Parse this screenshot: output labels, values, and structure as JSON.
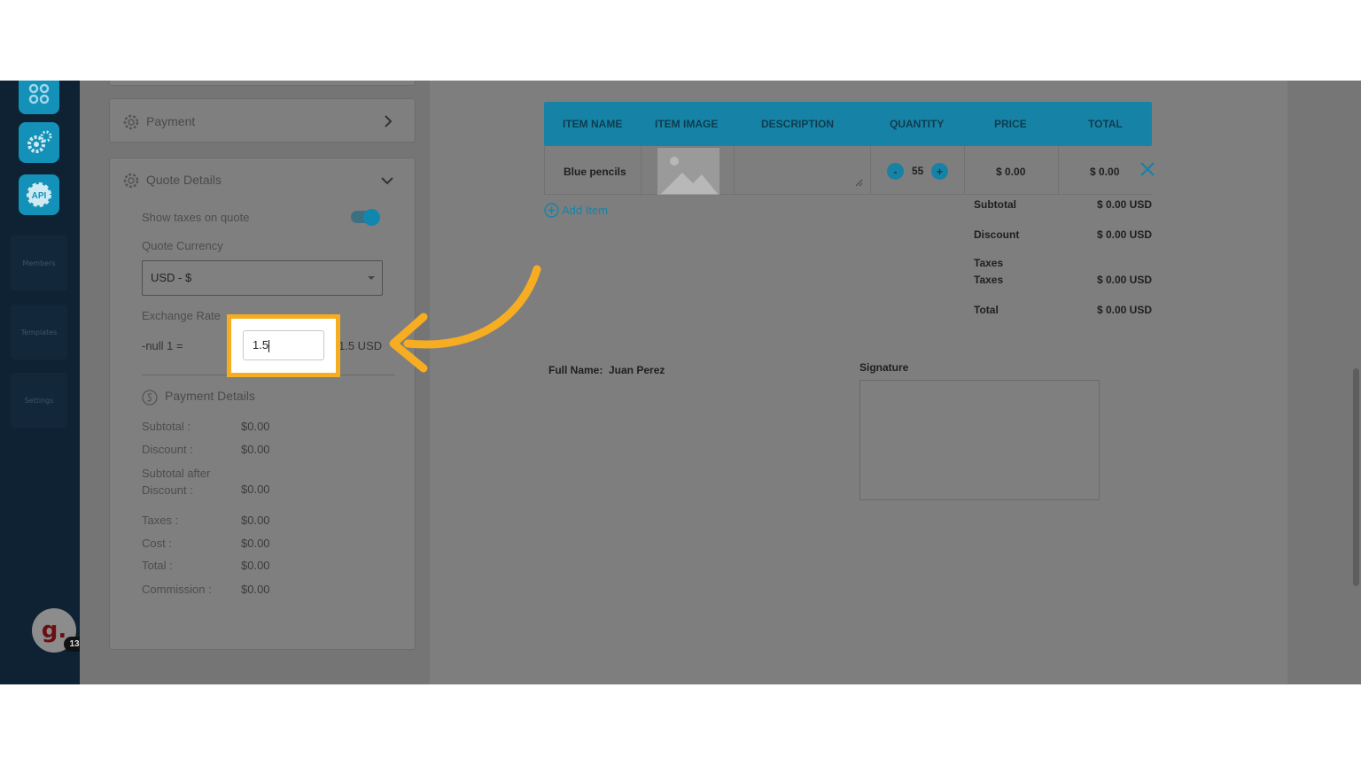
{
  "sidebar": {
    "members": "Members",
    "templates": "Templates",
    "settings": "Settings",
    "avatar_letter": "g.",
    "avatar_badge": "13",
    "api_label": "API"
  },
  "left_panel": {
    "payment_title": "Payment",
    "quote_details_title": "Quote Details",
    "show_taxes_label": "Show taxes on quote",
    "show_taxes_on": true,
    "quote_currency_label": "Quote Currency",
    "quote_currency_value": "USD - $",
    "exchange_rate_label": "Exchange Rate",
    "exchange_prefix": "-null 1 =",
    "exchange_input": "1.5",
    "exchange_suffix": "1.5 USD",
    "payment_details_title": "Payment Details",
    "details": [
      {
        "label": "Subtotal :",
        "value": "$0.00"
      },
      {
        "label": "Discount :",
        "value": "$0.00"
      },
      {
        "label": "Subtotal after Discount :",
        "value": "$0.00"
      },
      {
        "label": "Taxes :",
        "value": "$0.00"
      },
      {
        "label": "Cost :",
        "value": "$0.00"
      },
      {
        "label": "Total :",
        "value": "$0.00"
      },
      {
        "label": "Commission :",
        "value": "$0.00"
      }
    ]
  },
  "table": {
    "headers": [
      "ITEM NAME",
      "ITEM IMAGE",
      "DESCRIPTION",
      "QUANTITY",
      "PRICE",
      "TOTAL"
    ],
    "row": {
      "item_name": "Blue pencils",
      "quantity": "55",
      "price": "$ 0.00",
      "total": "$ 0.00",
      "minus": "-",
      "plus": "+"
    },
    "add_item": "Add Item"
  },
  "summary": [
    {
      "label": "Subtotal",
      "value": "$ 0.00 USD"
    },
    {
      "label": "Discount",
      "value": "$ 0.00 USD"
    },
    {
      "label": "Taxes",
      "value": ""
    },
    {
      "label": "Taxes",
      "value": "$ 0.00 USD"
    },
    {
      "label": "Total",
      "value": "$ 0.00 USD"
    }
  ],
  "signature": {
    "full_name_label": "Full Name:",
    "full_name_value": "Juan Perez",
    "signature_label": "Signature"
  },
  "colors": {
    "accent": "#1683a6",
    "highlight": "#f7ad22",
    "sidebar": "#0f2233"
  }
}
